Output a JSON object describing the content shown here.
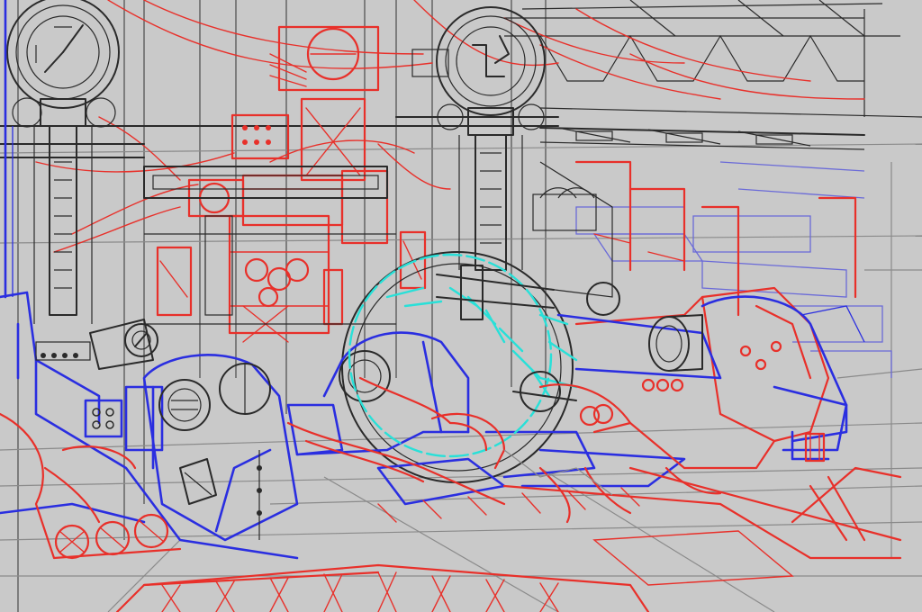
{
  "image": {
    "palette": {
      "background": "#c9c9c9",
      "ink": "#2a2a2a",
      "gray": "#6a6a6a",
      "red": "#e8302a",
      "blue": "#2a2ee0",
      "cyan": "#28e0d8",
      "violet": "#6a6ad8"
    }
  }
}
